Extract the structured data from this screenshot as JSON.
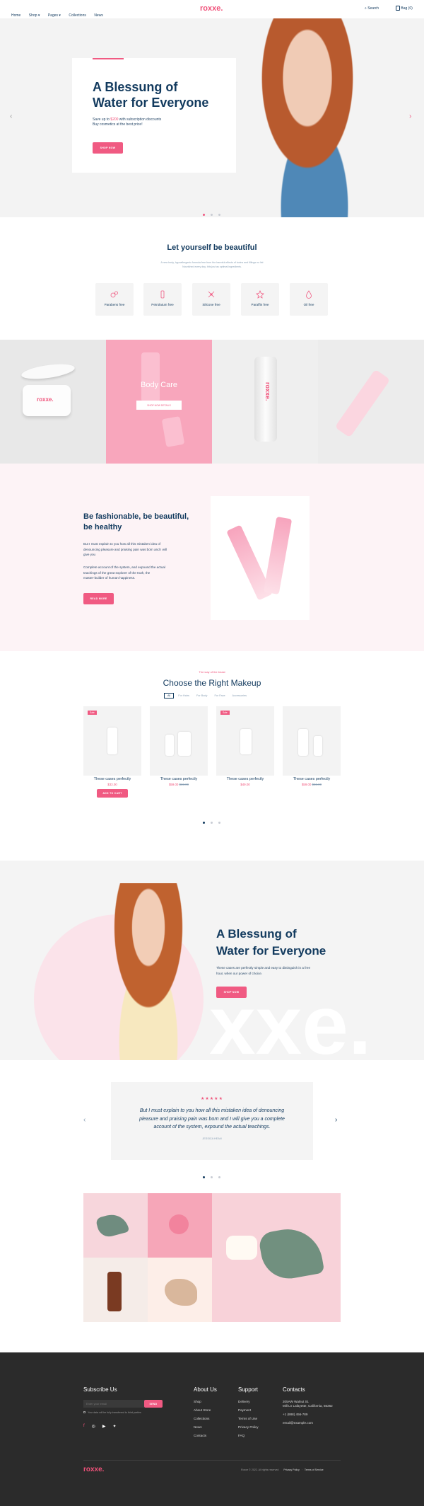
{
  "nav": {
    "links": [
      "Home",
      "Shop",
      "Pages",
      "Collections",
      "News"
    ],
    "logo": "roxxe.",
    "search": "Search",
    "bag": "Bag (0)"
  },
  "hero": {
    "title_line1": "A Blessung of",
    "title_line2": "Water for Everyone",
    "sub_prefix": "Save up to ",
    "sub_amount": "$200",
    "sub_suffix": " with subscription discounts",
    "sub_line2": "Buy cosmetics at the best price!",
    "button": "SHOP NOW"
  },
  "beautiful": {
    "title": "Let yourself be beautiful",
    "text_line1": "A new body, hypoallergenic formula free from the harmful effects of toxins and fillings no list",
    "text_line2": "Nourished every day, this just as optimal ingredients.",
    "features": [
      "Parabens free",
      "Petrolatum free",
      "Silicone free",
      "Paraffin free",
      "Oil free"
    ]
  },
  "body_care": {
    "title": "Body Care",
    "button": "SHOP NOW DETAILS"
  },
  "fashion": {
    "title_line1": "Be fashionable, be beautiful,",
    "title_line2": "be healthy",
    "p1_line1": "But I must explain to you how all this mistaken idea of",
    "p1_line2": "denouncing pleasure and praising pain was born and I will",
    "p1_line3": "give you",
    "p2_line1": "Complete account of the system, and expound the actual",
    "p2_line2": "teachings of the great explorer of the truth, the",
    "p2_line3": "master-builder of human happiness.",
    "button": "READ MORE"
  },
  "makeup": {
    "eyebrow": "The way of the beast",
    "title": "Choose the Right Makeup",
    "tabs": [
      "All",
      "For Hairs",
      "For Body",
      "For Face",
      "Accessories"
    ],
    "products": [
      {
        "badge": "Sale",
        "name": "These cases perfectly",
        "price": "$33.00",
        "old": "",
        "button": "ADD TO CART"
      },
      {
        "badge": "",
        "name": "These cases perfectly",
        "price": "$59.00",
        "old": "$33.00"
      },
      {
        "badge": "Sale",
        "name": "These cases perfectly",
        "price": "$49.00",
        "old": ""
      },
      {
        "badge": "",
        "name": "These cases perfectly",
        "price": "$59.00",
        "old": "$33.00"
      }
    ]
  },
  "blessing": {
    "title_line1": "A Blessung of",
    "title_line2": "Water for Everyone",
    "text_line1": "These cases are perfectly simple and easy to distinguish in a free",
    "text_line2": "hour, when our power of choice.",
    "button": "SHOP NOW",
    "watermark": "xxe."
  },
  "testimonial": {
    "stars": "★★★★★",
    "quote_line1": "But I must explain to you how all this mistaken idea of denouncing",
    "quote_line2": "pleasure and praising pain was born and I will give you a complete",
    "quote_line3": "account of the system, expound the actual teachings.",
    "author": "JESSICA HEAN"
  },
  "footer": {
    "subscribe": {
      "title": "Subscribe Us",
      "placeholder": "Enter your email",
      "button": "SEND",
      "consent": "Your data will be fully transferred to third parties"
    },
    "about": {
      "title": "About Us",
      "links": [
        "Shop",
        "About Store",
        "Collections",
        "News",
        "Contacts"
      ]
    },
    "support": {
      "title": "Support",
      "links": [
        "Delivery",
        "Payment",
        "Terms of Use",
        "Privacy Policy",
        "FAQ"
      ]
    },
    "contacts": {
      "title": "Contacts",
      "address_line1": "205AW Walnut St.",
      "address_line2": "Mill Ln Lafayette, California, 55262",
      "phone": "+1 (888) 456-789",
      "email": "email@example.com"
    },
    "logo": "roxxe.",
    "copyright": "Roxxe © 2022. All rights reserved",
    "privacy": "Privacy Policy",
    "terms": "Terms of Service"
  },
  "colors": {
    "accent": "#f05a82",
    "navy": "#123a5e",
    "dark": "#2b2b2b"
  }
}
